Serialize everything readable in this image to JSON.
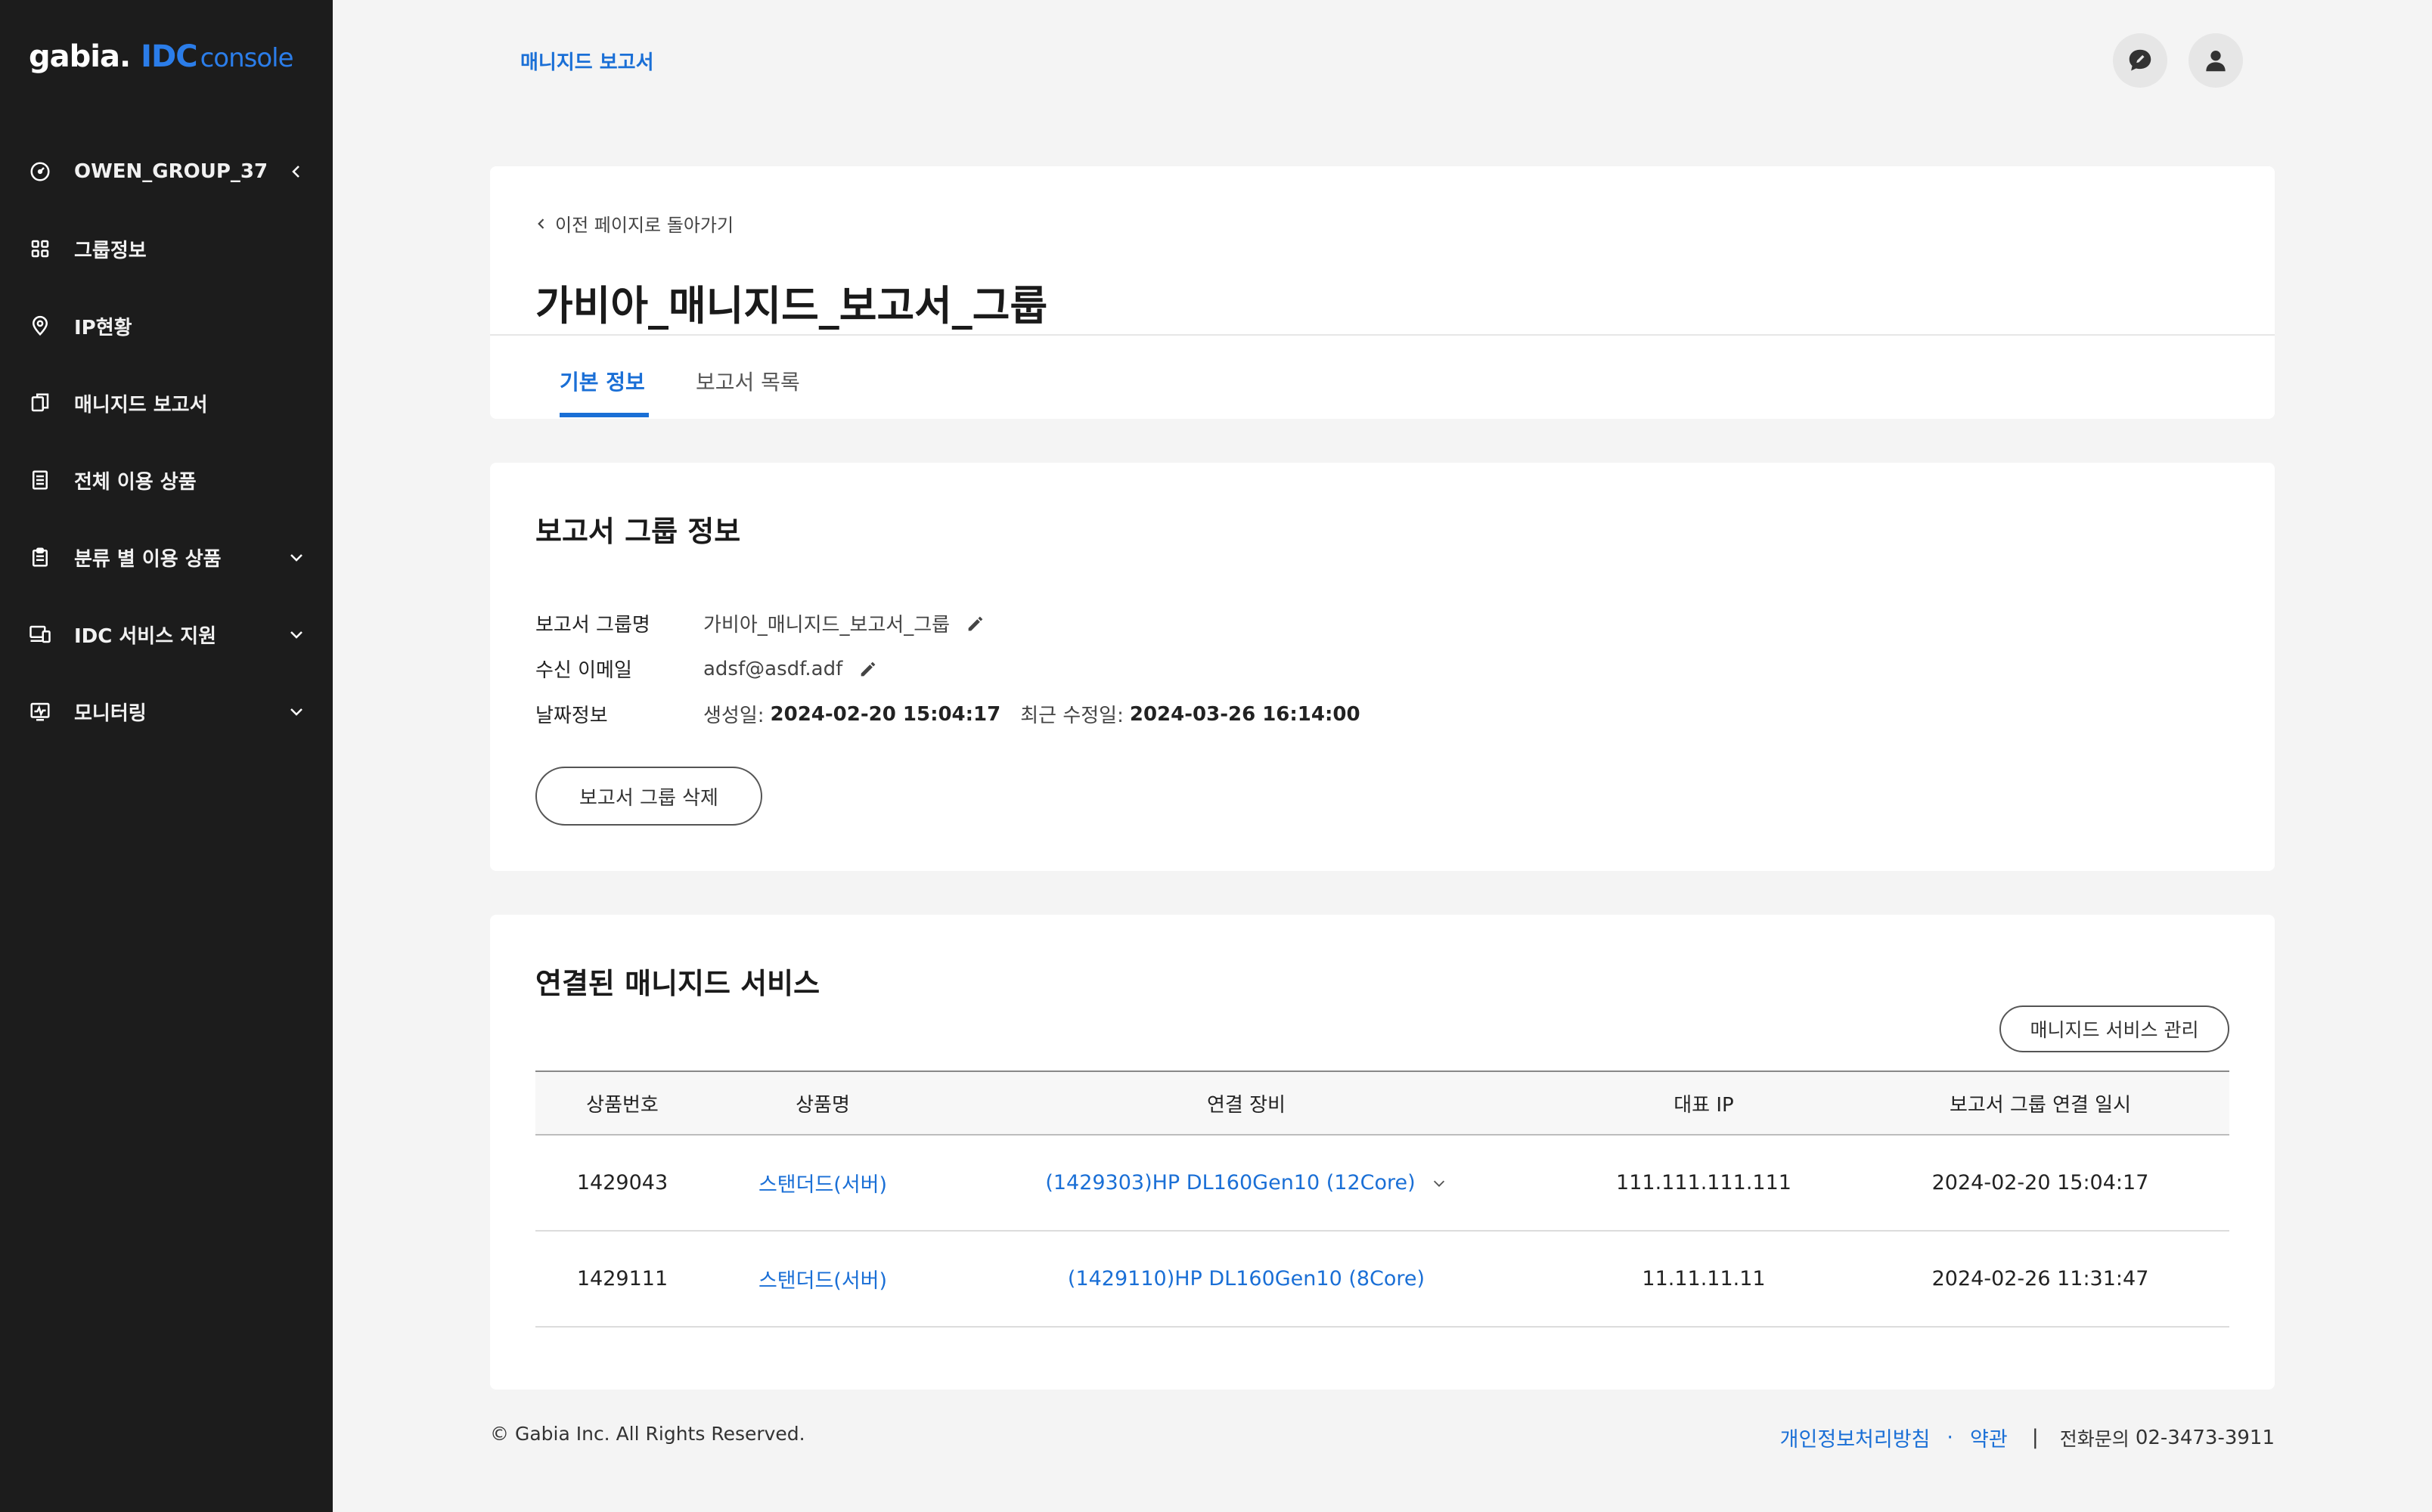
{
  "sidebar": {
    "logo": {
      "brand": "gabia.",
      "idc": "IDC",
      "console": "console"
    },
    "items": [
      {
        "label": "OWEN_GROUP_37",
        "icon": "dashboard-gauge-icon",
        "caret": "left"
      },
      {
        "label": "그룹정보",
        "icon": "grid-icon",
        "caret": ""
      },
      {
        "label": "IP현황",
        "icon": "location-pin-icon",
        "caret": ""
      },
      {
        "label": "매니지드 보고서",
        "icon": "copy-documents-icon",
        "caret": ""
      },
      {
        "label": "전체 이용 상품",
        "icon": "list-document-icon",
        "caret": ""
      },
      {
        "label": "분류 별 이용 상품",
        "icon": "clipboard-icon",
        "caret": "down"
      },
      {
        "label": "IDC 서비스 지원",
        "icon": "devices-icon",
        "caret": "down"
      },
      {
        "label": "모니터링",
        "icon": "monitor-chart-icon",
        "caret": "down"
      }
    ]
  },
  "topbar": {
    "title": "매니지드 보고서"
  },
  "header": {
    "back_label": "이전 페이지로 돌아가기",
    "title": "가비아_매니지드_보고서_그룹",
    "tabs": [
      {
        "label": "기본 정보"
      },
      {
        "label": "보고서 목록"
      }
    ]
  },
  "group_info": {
    "heading": "보고서 그룹 정보",
    "name_label": "보고서 그룹명",
    "name_value": "가비아_매니지드_보고서_그룹",
    "email_label": "수신 이메일",
    "email_value": "adsf@asdf.adf",
    "date_label": "날짜정보",
    "created_label": "생성일:",
    "created_value": "2024-02-20 15:04:17",
    "modified_label": "최근 수정일:",
    "modified_value": "2024-03-26 16:14:00",
    "delete_button": "보고서 그룹 삭제"
  },
  "services": {
    "heading": "연결된 매니지드 서비스",
    "manage_button": "매니지드 서비스 관리",
    "columns": [
      "상품번호",
      "상품명",
      "연결 장비",
      "대표 IP",
      "보고서 그룹 연결 일시"
    ],
    "rows": [
      {
        "number": "1429043",
        "name": "스탠더드(서버)",
        "device": "(1429303)HP DL160Gen10 (12Core)",
        "ip": "111.111.111.111",
        "linked_at": "2024-02-20 15:04:17"
      },
      {
        "number": "1429111",
        "name": "스탠더드(서버)",
        "device": "(1429110)HP DL160Gen10 (8Core)",
        "ip": "11.11.11.11",
        "linked_at": "2024-02-26 11:31:47"
      }
    ]
  },
  "footer": {
    "copyright": "© Gabia Inc. All Rights Reserved.",
    "privacy": "개인정보처리방침",
    "dot": "·",
    "terms": "약관",
    "separator": "|",
    "phone_label": "전화문의",
    "phone": "02-3473-3911"
  },
  "colors": {
    "accent": "#1a6fd6",
    "sidebar_bg": "#1c1c1c",
    "page_bg": "#f4f4f4"
  }
}
